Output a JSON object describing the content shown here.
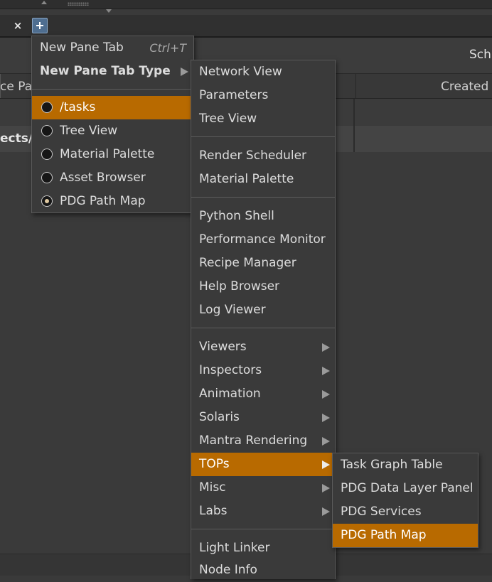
{
  "header": {
    "right_label": "Sch"
  },
  "table": {
    "col_path_label": "ce Pa",
    "col_created_label": "Created I",
    "row_2_text": "ects/"
  },
  "tabbar": {
    "close_label": "×"
  },
  "context_menu": {
    "new_pane_tab": "New Pane Tab",
    "new_pane_tab_shortcut": "Ctrl+T",
    "new_pane_tab_type": "New Pane Tab Type",
    "pane_items": [
      {
        "label": "/tasks",
        "selected": true
      },
      {
        "label": "Tree View",
        "selected": false
      },
      {
        "label": "Material Palette",
        "selected": false
      },
      {
        "label": "Asset Browser",
        "selected": false
      },
      {
        "label": "PDG Path Map",
        "selected": false
      }
    ]
  },
  "pane_type_menu": {
    "group1": [
      "Network View",
      "Parameters",
      "Tree View"
    ],
    "group2": [
      "Render Scheduler",
      "Material Palette"
    ],
    "group3": [
      "Python Shell",
      "Performance Monitor",
      "Recipe Manager",
      "Help Browser",
      "Log Viewer"
    ],
    "group4": [
      "Viewers",
      "Inspectors",
      "Animation",
      "Solaris",
      "Mantra Rendering",
      "TOPs",
      "Misc",
      "Labs"
    ],
    "group5": [
      "Light Linker",
      "Node Info"
    ]
  },
  "tops_menu": {
    "items": [
      "Task Graph Table",
      "PDG Data Layer Panel",
      "PDG Services",
      "PDG Path Map"
    ]
  },
  "colors": {
    "highlight": "#b86a00",
    "menu_bg": "#3a3a3a",
    "accent_blue": "#4f6e90"
  }
}
